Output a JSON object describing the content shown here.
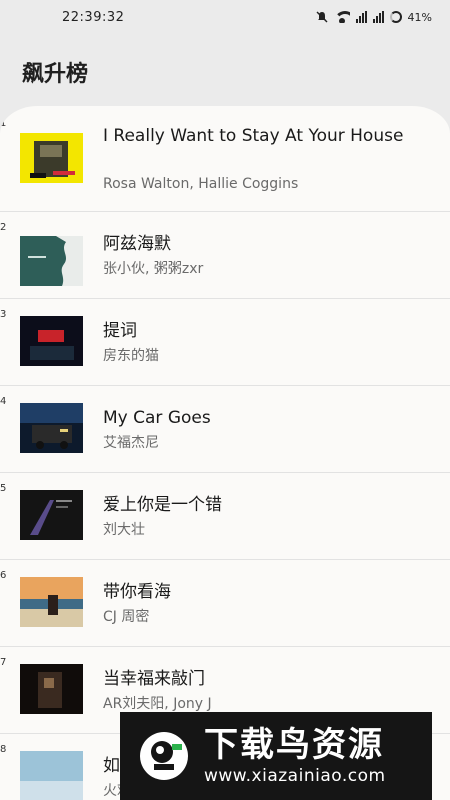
{
  "status_bar": {
    "time": "22:39:32",
    "battery": "41%",
    "icons": [
      "mute-icon",
      "wifi-icon",
      "signal-icon",
      "signal-icon",
      "battery-icon"
    ]
  },
  "page": {
    "title": "飙升榜"
  },
  "songs": [
    {
      "rank": "1",
      "title": "I Really Want to Stay At Your House",
      "artist": "Rosa Walton, Hallie Coggins"
    },
    {
      "rank": "2",
      "title": "阿兹海默",
      "artist": "张小伙, 粥粥zxr"
    },
    {
      "rank": "3",
      "title": "提词",
      "artist": "房东的猫"
    },
    {
      "rank": "4",
      "title": "My Car Goes",
      "artist": "艾福杰尼"
    },
    {
      "rank": "5",
      "title": "爱上你是一个错",
      "artist": "刘大壮"
    },
    {
      "rank": "6",
      "title": "带你看海",
      "artist": "CJ 周密"
    },
    {
      "rank": "7",
      "title": "当幸福来敲门",
      "artist": "AR刘夫阳, Jony J"
    },
    {
      "rank": "8",
      "title": "如",
      "artist": "火鸡"
    }
  ],
  "watermark": {
    "title": "下载鸟资源",
    "url": "www.xiazainiao.com"
  }
}
